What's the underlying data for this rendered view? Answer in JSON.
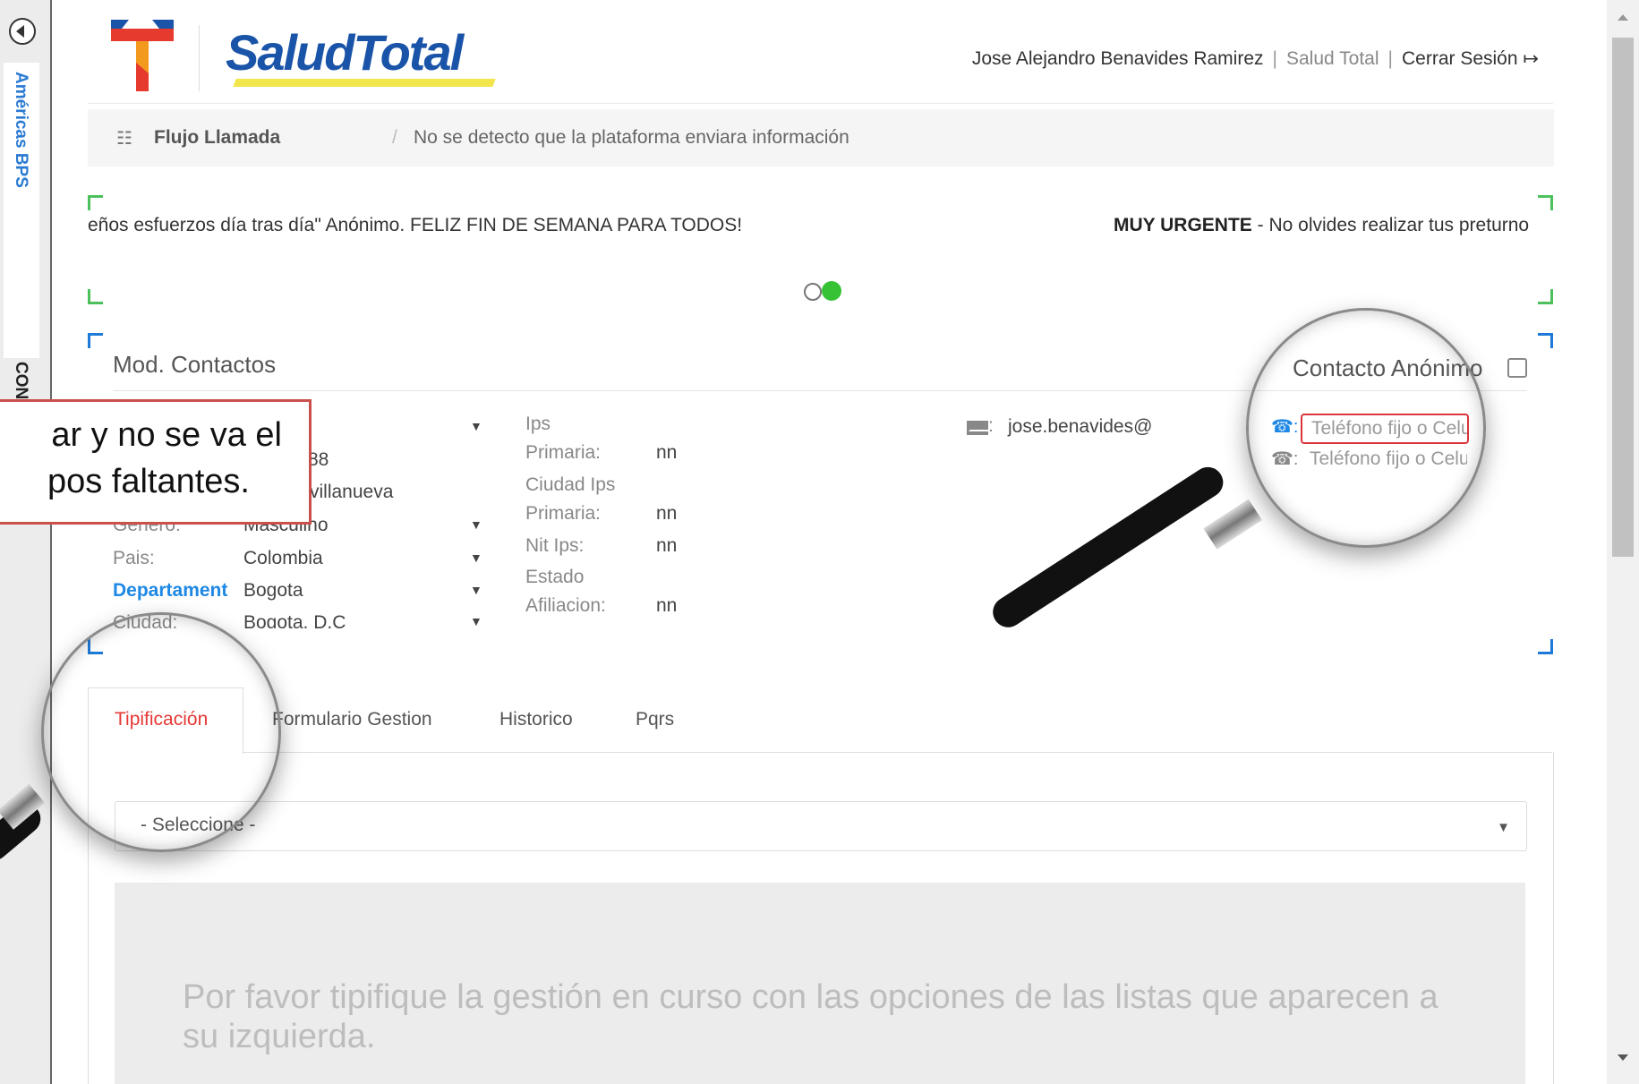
{
  "sidebar": {
    "tab_1": "Américas BPS",
    "tab_2": "CON"
  },
  "header": {
    "brand": "SaludTotal",
    "user_name": "Jose Alejandro Benavides Ramirez",
    "separator": "|",
    "company": "Salud Total",
    "logout_label": "Cerrar Sesión"
  },
  "breadcrumb": {
    "home": "Flujo Llamada",
    "separator": "/",
    "current": "No se detecto que la plataforma enviara información"
  },
  "ticker": {
    "left_text": "eños esfuerzos día tras día\" Anónimo. FELIZ FIN DE SEMANA PARA TODOS!",
    "right_bold": "MUY URGENTE",
    "right_text": " - No olvides realizar tus preturno"
  },
  "contacts": {
    "title": "Mod. Contactos",
    "anonymous_label": "Contacto Anónimo",
    "fields": [
      {
        "label": "",
        "value": "88"
      },
      {
        "label": "",
        "value": "villanueva"
      },
      {
        "label": "Genero:",
        "value": "Masculino"
      },
      {
        "label": "Pais:",
        "value": "Colombia"
      },
      {
        "label": "Departament",
        "value": "Bogota"
      },
      {
        "label": "Ciudad:",
        "value": "Bogota, D.C"
      }
    ],
    "ips": [
      {
        "label_1": "Ips",
        "label_2": "Primaria:",
        "value": "nn"
      },
      {
        "label_1": "Ciudad Ips",
        "label_2": "Primaria:",
        "value": "nn"
      },
      {
        "label_1": "Nit Ips:",
        "label_2": "",
        "value": "nn"
      },
      {
        "label_1": "Estado",
        "label_2": "Afiliacion:",
        "value": "nn"
      }
    ],
    "email": "jose.benavides@",
    "phone_placeholder": "Teléfono fijo o Celular"
  },
  "tabs": [
    "Tipificación",
    "Formulario Gestion",
    "Historico",
    "Pqrs"
  ],
  "select": {
    "placeholder": "- Seleccione -"
  },
  "info_text": "Por favor tipifique la gestión en curso con las opciones de las listas que aparecen a su izquierda.",
  "callout": {
    "line_1": "ar y no se va el",
    "line_2": "pos faltantes."
  },
  "colors": {
    "brand_blue": "#1a54a8",
    "active_tab": "#e53935",
    "link_blue": "#1e88e5",
    "online_green": "#35c235",
    "bracket_green": "#4cc15b",
    "bracket_blue": "#1e7ad8"
  }
}
